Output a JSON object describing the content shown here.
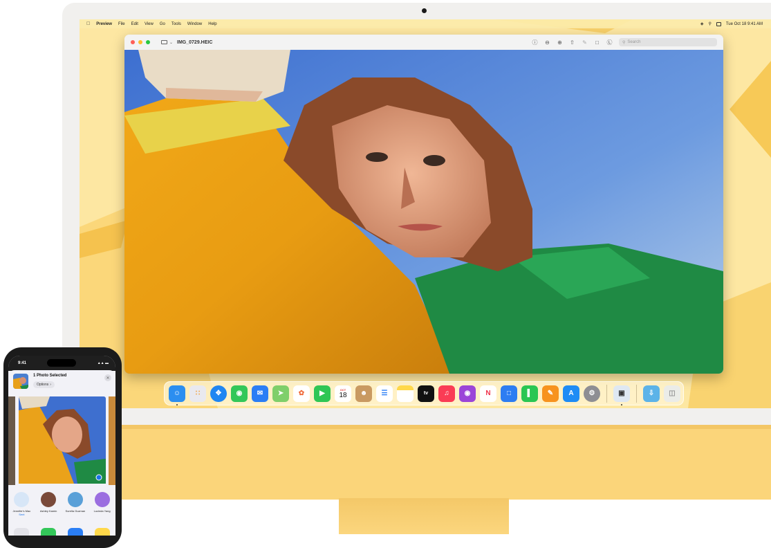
{
  "menubar": {
    "app_name": "Preview",
    "menus": [
      "File",
      "Edit",
      "View",
      "Go",
      "Tools",
      "Window",
      "Help"
    ],
    "datetime": "Tue Oct 18  9:41 AM"
  },
  "window": {
    "title": "IMG_0729.HEIC",
    "search_placeholder": "Search",
    "toolbar_icons": [
      "info-icon",
      "zoom-out-icon",
      "zoom-in-icon",
      "share-icon",
      "markup-pen-icon",
      "rotate-icon",
      "annotate-icon"
    ]
  },
  "dock": {
    "apps": [
      {
        "name": "finder",
        "bg": "#2b8ef0"
      },
      {
        "name": "launchpad",
        "bg": "#e9e9ef"
      },
      {
        "name": "safari",
        "bg": "#1f86f2"
      },
      {
        "name": "messages",
        "bg": "#33c759"
      },
      {
        "name": "mail",
        "bg": "#2a7ef5"
      },
      {
        "name": "maps",
        "bg": "#7fcf6a"
      },
      {
        "name": "photos",
        "bg": "#ffffff"
      },
      {
        "name": "facetime",
        "bg": "#2fc655"
      },
      {
        "name": "calendar",
        "bg": "#ffffff"
      },
      {
        "name": "contacts",
        "bg": "#c99a62"
      },
      {
        "name": "reminders",
        "bg": "#ffffff"
      },
      {
        "name": "notes",
        "bg": "#ffd84a"
      },
      {
        "name": "tv",
        "bg": "#111111"
      },
      {
        "name": "music",
        "bg": "#fa3c55"
      },
      {
        "name": "podcasts",
        "bg": "#9b45d8"
      },
      {
        "name": "news",
        "bg": "#ffffff"
      },
      {
        "name": "keynote",
        "bg": "#2d7df2"
      },
      {
        "name": "numbers",
        "bg": "#2bc653"
      },
      {
        "name": "pages",
        "bg": "#f7931e"
      },
      {
        "name": "app-store",
        "bg": "#1e8cf5"
      },
      {
        "name": "system-settings",
        "bg": "#8e8e93"
      }
    ],
    "calendar": {
      "month": "OCT",
      "day": "18"
    },
    "tv_label": "tv"
  },
  "phone": {
    "time": "9:41",
    "sheet_title": "1 Photo Selected",
    "options_label": "Options",
    "people": [
      {
        "name": "Jennifer's Mac",
        "sub": "Sent",
        "color": "#d7e6f7"
      },
      {
        "name": "Ashley Kamin",
        "sub": "",
        "color": "#7a4a3a"
      },
      {
        "name": "Surella Guzman",
        "sub": "",
        "color": "#5aa0d8"
      },
      {
        "name": "Lucinda Yang",
        "sub": "",
        "color": "#9b6ee0"
      }
    ]
  },
  "colors": {
    "wallpaper": "#fce9a8",
    "imac_chin": "#fbd57a",
    "accent_blue": "#1a73e8"
  }
}
